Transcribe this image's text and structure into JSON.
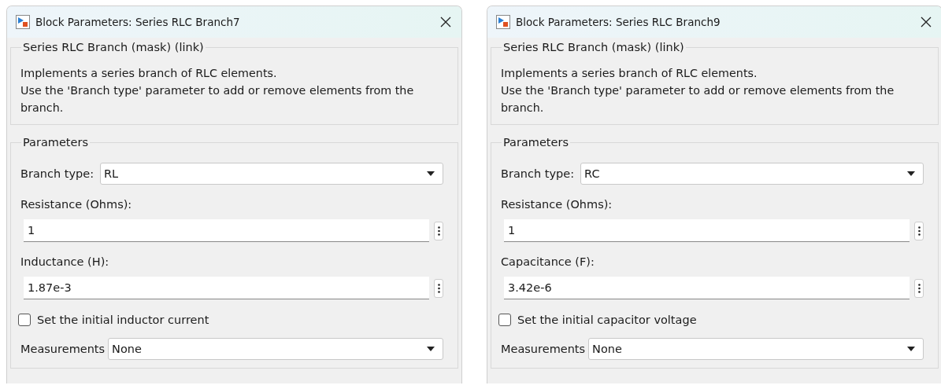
{
  "dialogs": [
    {
      "title": "Block Parameters: Series RLC Branch7",
      "description": {
        "legend": "Series RLC Branch (mask) (link)",
        "lines": [
          "Implements a series branch of RLC elements.",
          "Use the 'Branch type' parameter to add or remove elements from the branch."
        ]
      },
      "parameters": {
        "legend": "Parameters",
        "branch_type": {
          "label": "Branch type:",
          "value": "RL"
        },
        "fields": [
          {
            "label": "Resistance (Ohms):",
            "value": "1"
          },
          {
            "label": "Inductance (H):",
            "value": "1.87e-3"
          }
        ],
        "checkbox": {
          "label": "Set the initial inductor current",
          "checked": false
        },
        "measurements": {
          "label": "Measurements",
          "value": "None"
        }
      }
    },
    {
      "title": "Block Parameters: Series RLC Branch9",
      "description": {
        "legend": "Series RLC Branch (mask) (link)",
        "lines": [
          "Implements a series branch of RLC elements.",
          "Use the 'Branch type' parameter to add or remove elements from the branch."
        ]
      },
      "parameters": {
        "legend": "Parameters",
        "branch_type": {
          "label": "Branch type:",
          "value": "RC"
        },
        "fields": [
          {
            "label": "Resistance (Ohms):",
            "value": "1"
          },
          {
            "label": "Capacitance (F):",
            "value": "3.42e-6"
          }
        ],
        "checkbox": {
          "label": "Set the initial capacitor voltage",
          "checked": false
        },
        "measurements": {
          "label": "Measurements",
          "value": "None"
        }
      }
    }
  ]
}
